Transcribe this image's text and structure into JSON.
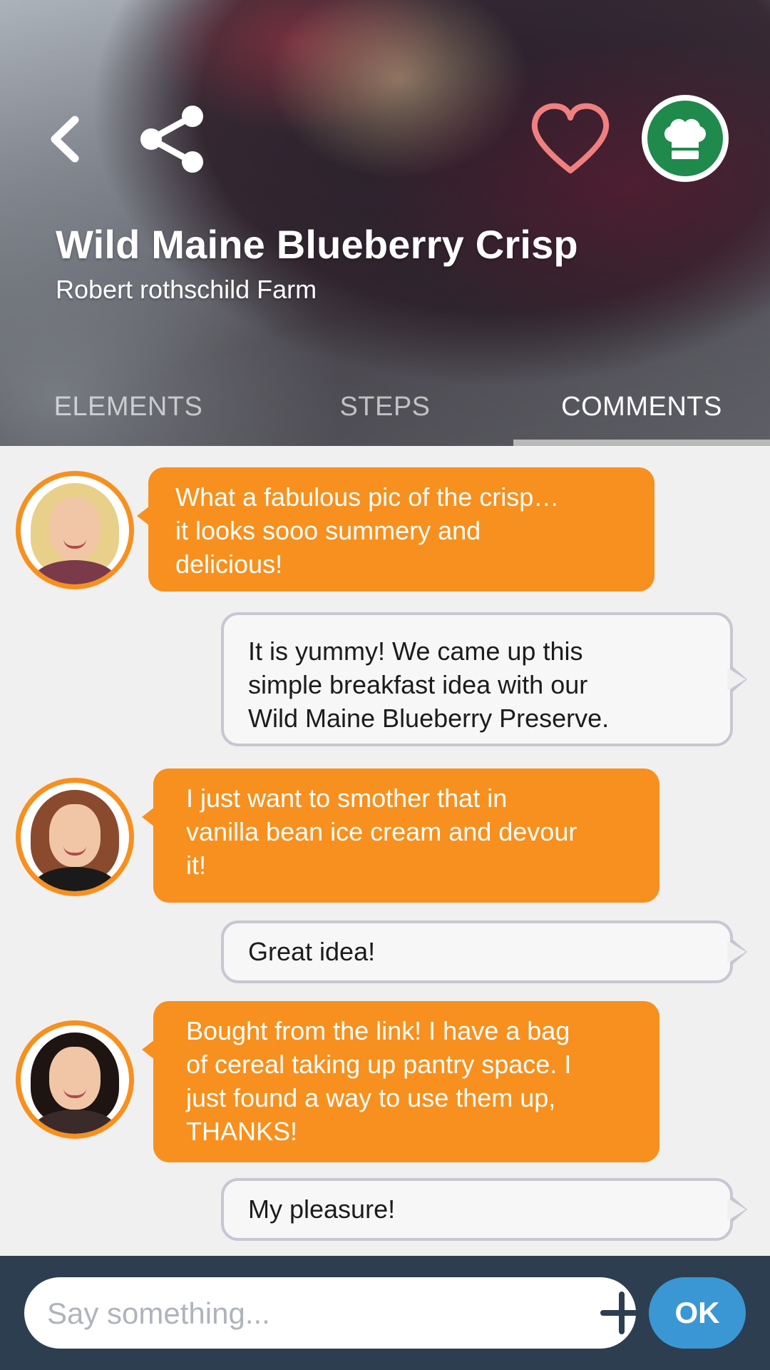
{
  "header": {
    "title": "Wild Maine Blueberry Crisp",
    "source": "Robert rothschild Farm",
    "icons": {
      "back": "back-chevron-icon",
      "share": "share-icon",
      "favorite": "heart-outline-icon",
      "chef": "chef-hat-icon"
    },
    "colors": {
      "heart": "#f08080",
      "chef_badge": "#1f8a4c"
    }
  },
  "tabs": [
    {
      "label": "ELEMENTS",
      "active": false
    },
    {
      "label": "STEPS",
      "active": false
    },
    {
      "label": "COMMENTS",
      "active": true
    }
  ],
  "messages": [
    {
      "from": "user",
      "lines": [
        "What a fabulous pic of the crisp…",
        "it looks sooo summery and",
        "delicious!"
      ]
    },
    {
      "from": "author",
      "lines": [
        "It is yummy! We came up this",
        "simple breakfast idea with our",
        "Wild Maine Blueberry Preserve."
      ]
    },
    {
      "from": "user",
      "lines": [
        "I just want to smother that in",
        "vanilla bean ice cream and devour",
        "it!"
      ]
    },
    {
      "from": "author",
      "lines": [
        "Great idea!"
      ]
    },
    {
      "from": "user",
      "lines": [
        "Bought from the link! I have a bag",
        "of cereal taking up pantry space. I",
        "just found a way to use them up,",
        "THANKS!"
      ]
    },
    {
      "from": "author",
      "lines": [
        "My pleasure!"
      ]
    }
  ],
  "composer": {
    "placeholder": "Say something...",
    "value": "",
    "add_icon": "plus-icon",
    "ok_label": "OK"
  },
  "colors": {
    "incoming_bubble": "#f7901e",
    "outgoing_border": "#c7c7d3",
    "footer": "#2d3e50",
    "ok_button": "#3a97d4"
  }
}
